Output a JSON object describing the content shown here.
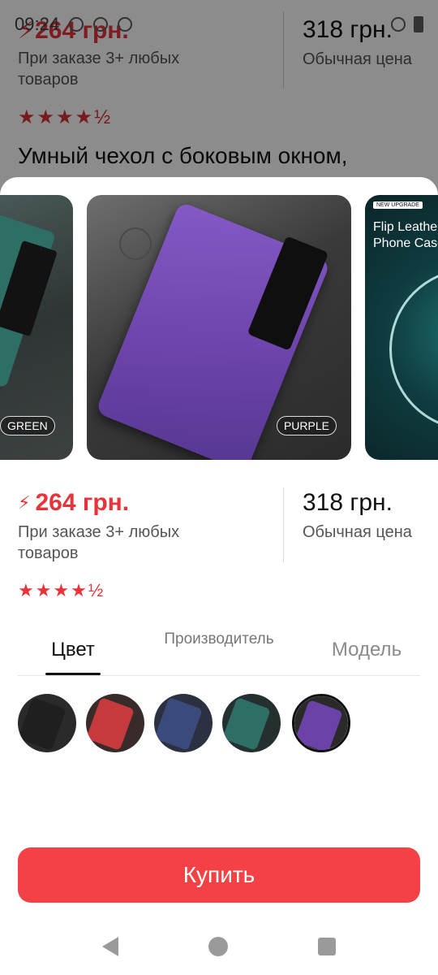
{
  "status_bar": {
    "time": "09:24"
  },
  "background_page": {
    "sale_price": "264 грн.",
    "sale_note": "При заказе 3+ любых товаров",
    "regular_price": "318 грн.",
    "regular_note": "Обычная цена",
    "stars": "★★★★½",
    "title": "Умный чехол с боковым окном,"
  },
  "gallery": {
    "cards": [
      {
        "label": "GREEN"
      },
      {
        "label": "PURPLE"
      },
      {
        "badge": "NEW UPGRADE",
        "title": "Flip Leather Phone Case"
      }
    ]
  },
  "price": {
    "sale_price": "264 грн.",
    "sale_note": "При заказе 3+ любых товаров",
    "regular_price": "318 грн.",
    "regular_note": "Обычная цена"
  },
  "rating": {
    "stars": "★★★★½",
    "value": 4.5
  },
  "tabs": [
    {
      "label": "Цвет",
      "active": true
    },
    {
      "label": "Производитель",
      "active": false
    },
    {
      "label": "Модель",
      "active": false
    }
  ],
  "swatches": [
    {
      "color": "black",
      "hex": "#1f1f1f",
      "selected": false
    },
    {
      "color": "red",
      "hex": "#c63a3d",
      "selected": false
    },
    {
      "color": "blue",
      "hex": "#3a4a7a",
      "selected": false
    },
    {
      "color": "green",
      "hex": "#2f6e64",
      "selected": false
    },
    {
      "color": "purple",
      "hex": "#6a42a8",
      "selected": true
    }
  ],
  "buy_button": {
    "label": "Купить"
  },
  "colors": {
    "accent": "#f34146",
    "sale": "#e8333a"
  }
}
